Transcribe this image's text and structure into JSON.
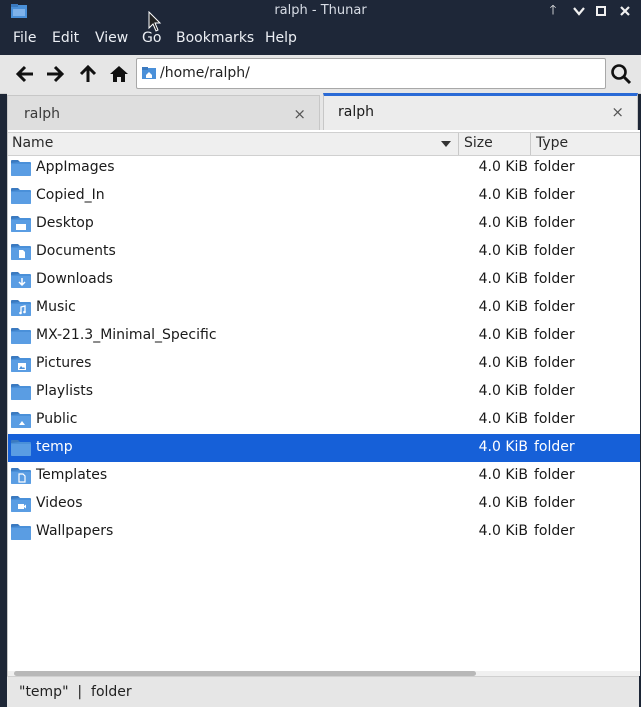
{
  "window": {
    "title": "ralph - Thunar"
  },
  "menu": [
    "File",
    "Edit",
    "View",
    "Go",
    "Bookmarks",
    "Help"
  ],
  "location": {
    "path": "/home/ralph/"
  },
  "tabs": [
    {
      "label": "ralph",
      "close": "×",
      "active": false
    },
    {
      "label": "ralph",
      "close": "×",
      "active": true
    }
  ],
  "columns": {
    "name": "Name",
    "size": "Size",
    "type": "Type"
  },
  "files": [
    {
      "name": "AppImages",
      "size": "4.0 KiB",
      "type": "folder",
      "icon": "folder-icon"
    },
    {
      "name": "Copied_In",
      "size": "4.0 KiB",
      "type": "folder",
      "icon": "folder-icon"
    },
    {
      "name": "Desktop",
      "size": "4.0 KiB",
      "type": "folder",
      "icon": "desktop-folder-icon"
    },
    {
      "name": "Documents",
      "size": "4.0 KiB",
      "type": "folder",
      "icon": "documents-folder-icon"
    },
    {
      "name": "Downloads",
      "size": "4.0 KiB",
      "type": "folder",
      "icon": "downloads-folder-icon"
    },
    {
      "name": "Music",
      "size": "4.0 KiB",
      "type": "folder",
      "icon": "music-folder-icon"
    },
    {
      "name": "MX-21.3_Minimal_Specific",
      "size": "4.0 KiB",
      "type": "folder",
      "icon": "folder-icon"
    },
    {
      "name": "Pictures",
      "size": "4.0 KiB",
      "type": "folder",
      "icon": "pictures-folder-icon"
    },
    {
      "name": "Playlists",
      "size": "4.0 KiB",
      "type": "folder",
      "icon": "folder-icon"
    },
    {
      "name": "Public",
      "size": "4.0 KiB",
      "type": "folder",
      "icon": "public-folder-icon"
    },
    {
      "name": "temp",
      "size": "4.0 KiB",
      "type": "folder",
      "icon": "folder-icon",
      "selected": true
    },
    {
      "name": "Templates",
      "size": "4.0 KiB",
      "type": "folder",
      "icon": "templates-folder-icon"
    },
    {
      "name": "Videos",
      "size": "4.0 KiB",
      "type": "folder",
      "icon": "videos-folder-icon"
    },
    {
      "name": "Wallpapers",
      "size": "4.0 KiB",
      "type": "folder",
      "icon": "folder-icon"
    }
  ],
  "status": {
    "text": "\"temp\"  |  folder"
  },
  "colors": {
    "selection": "#1660d8",
    "titlebar": "#1e2738",
    "folder": "#4a90d9",
    "tab_accent": "#2a6ad6"
  }
}
